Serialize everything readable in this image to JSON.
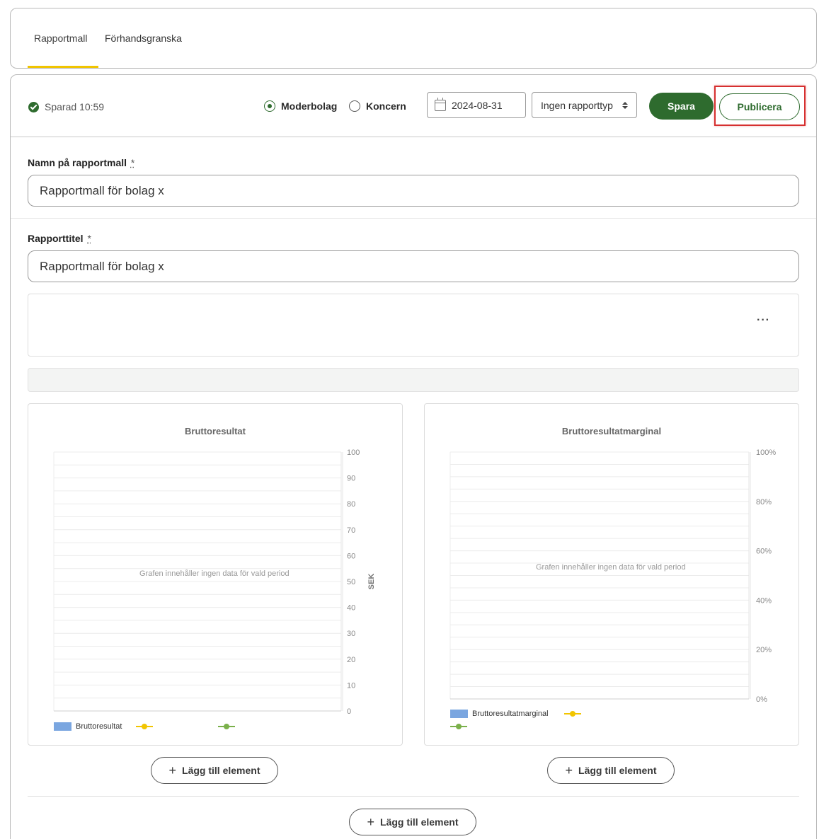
{
  "tabs": [
    {
      "label": "Rapportmall",
      "active": true
    },
    {
      "label": "Förhandsgranska",
      "active": false
    }
  ],
  "toolbar": {
    "saved_text": "Sparad 10:59",
    "radio_options": [
      {
        "label": "Moderbolag",
        "checked": true
      },
      {
        "label": "Koncern",
        "checked": false
      }
    ],
    "date_value": "2024-08-31",
    "report_type": "Ingen rapporttyp",
    "save_label": "Spara",
    "publish_label": "Publicera"
  },
  "form": {
    "template_name_label": "Namn på rapportmall",
    "template_name_value": "Rapportmall för bolag x",
    "report_title_label": "Rapporttitel",
    "report_title_value": "Rapportmall för bolag x",
    "required_marker": "*",
    "more_label": "···"
  },
  "colors": {
    "accent": "#2e6b2e",
    "tab_underline": "#f0c400",
    "highlight": "#d63030",
    "bar_series": "#7aa6e0",
    "line_yellow": "#f2c500",
    "line_green": "#7ab04a"
  },
  "chart_data": [
    {
      "type": "bar",
      "title": "Bruttoresultat",
      "ylabel": "SEK",
      "ylim": [
        0,
        100
      ],
      "yticks": [
        "100",
        "90",
        "80",
        "70",
        "60",
        "50",
        "40",
        "30",
        "20",
        "10",
        "0"
      ],
      "categories": [],
      "series": [
        {
          "name": "Bruttoresultat",
          "values": []
        },
        {
          "name": "",
          "values": []
        },
        {
          "name": "",
          "values": []
        }
      ],
      "no_data_text": "Grafen innehåller ingen data för vald period",
      "grid": true,
      "legend": "bottom-left"
    },
    {
      "type": "bar",
      "title": "Bruttoresultatmarginal",
      "ylabel": "",
      "ylim": [
        0,
        100
      ],
      "yticks": [
        "100%",
        "80%",
        "60%",
        "40%",
        "20%",
        "0%"
      ],
      "categories": [],
      "series": [
        {
          "name": "Bruttoresultatmarginal",
          "values": []
        },
        {
          "name": "",
          "values": []
        },
        {
          "name": "",
          "values": []
        }
      ],
      "no_data_text": "Grafen innehåller ingen data för vald period",
      "grid": true,
      "legend": "bottom-left"
    }
  ],
  "add_element_label": "Lägg till element"
}
